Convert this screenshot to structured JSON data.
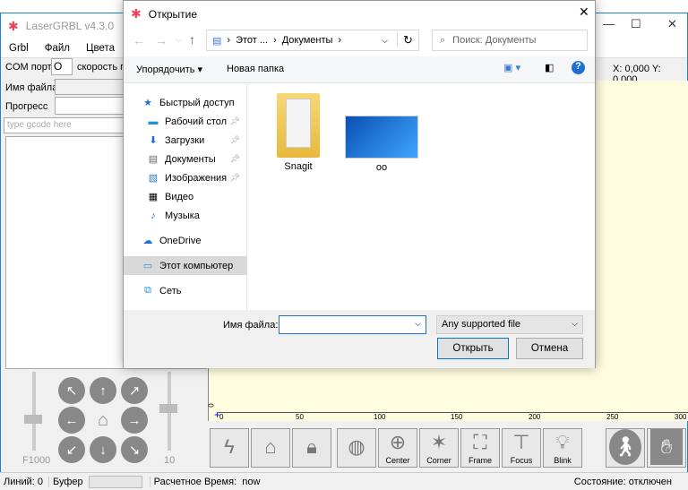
{
  "main": {
    "title": "LaserGRBL v4.3.0",
    "menu": [
      "Grbl",
      "Файл",
      "Цвета"
    ],
    "com_label": "COM порт",
    "com_value": "O",
    "speed_label": "скорость п",
    "file_label": "Имя файла",
    "progress_label": "Прогресс",
    "gcode_placeholder": "type gcode here",
    "coords": "X: 0,000 Y: 0,000",
    "speed_value": "F1000",
    "step_value": "10",
    "ruler_ticks": [
      "0",
      "50",
      "100",
      "150",
      "200",
      "250",
      "300"
    ],
    "ruler_y": "0",
    "tools": [
      {
        "icon": "lightning-icon",
        "label": ""
      },
      {
        "icon": "home-search-icon",
        "label": ""
      },
      {
        "icon": "lock-icon",
        "label": ""
      },
      {
        "icon": "globe-icon",
        "label": ""
      },
      {
        "icon": "center-icon",
        "label": "Center"
      },
      {
        "icon": "corner-icon",
        "label": "Corner"
      },
      {
        "icon": "frame-icon",
        "label": "Frame"
      },
      {
        "icon": "focus-icon",
        "label": "Focus"
      },
      {
        "icon": "blink-icon",
        "label": "Blink"
      }
    ],
    "status": {
      "lines_label": "Линий:",
      "lines": "0",
      "buffer_label": "Буфер",
      "time_label": "Расчетное Время:",
      "time": "now",
      "state_label": "Состояние:",
      "state": "отключен"
    }
  },
  "dialog": {
    "title": "Открытие",
    "path": [
      "Этот ...",
      "Документы"
    ],
    "search_placeholder": "Поиск: Документы",
    "organize": "Упорядочить",
    "new_folder": "Новая папка",
    "nav": [
      {
        "label": "Быстрый доступ",
        "icon": "star-icon"
      },
      {
        "label": "Рабочий стол",
        "icon": "desktop-icon",
        "pin": true
      },
      {
        "label": "Загрузки",
        "icon": "download-icon",
        "pin": true
      },
      {
        "label": "Документы",
        "icon": "documents-icon",
        "pin": true
      },
      {
        "label": "Изображения",
        "icon": "pictures-icon",
        "pin": true
      },
      {
        "label": "Видео",
        "icon": "video-icon"
      },
      {
        "label": "Музыка",
        "icon": "music-icon"
      },
      {
        "label": "OneDrive",
        "icon": "cloud-icon"
      },
      {
        "label": "Этот компьютер",
        "icon": "computer-icon",
        "selected": true
      },
      {
        "label": "Сеть",
        "icon": "network-icon"
      }
    ],
    "files": [
      {
        "name": "Snagit",
        "type": "folder"
      },
      {
        "name": "oo",
        "type": "image"
      }
    ],
    "filename_label": "Имя файла:",
    "filename_value": "",
    "filter": "Any supported file",
    "open": "Открыть",
    "cancel": "Отмена"
  }
}
